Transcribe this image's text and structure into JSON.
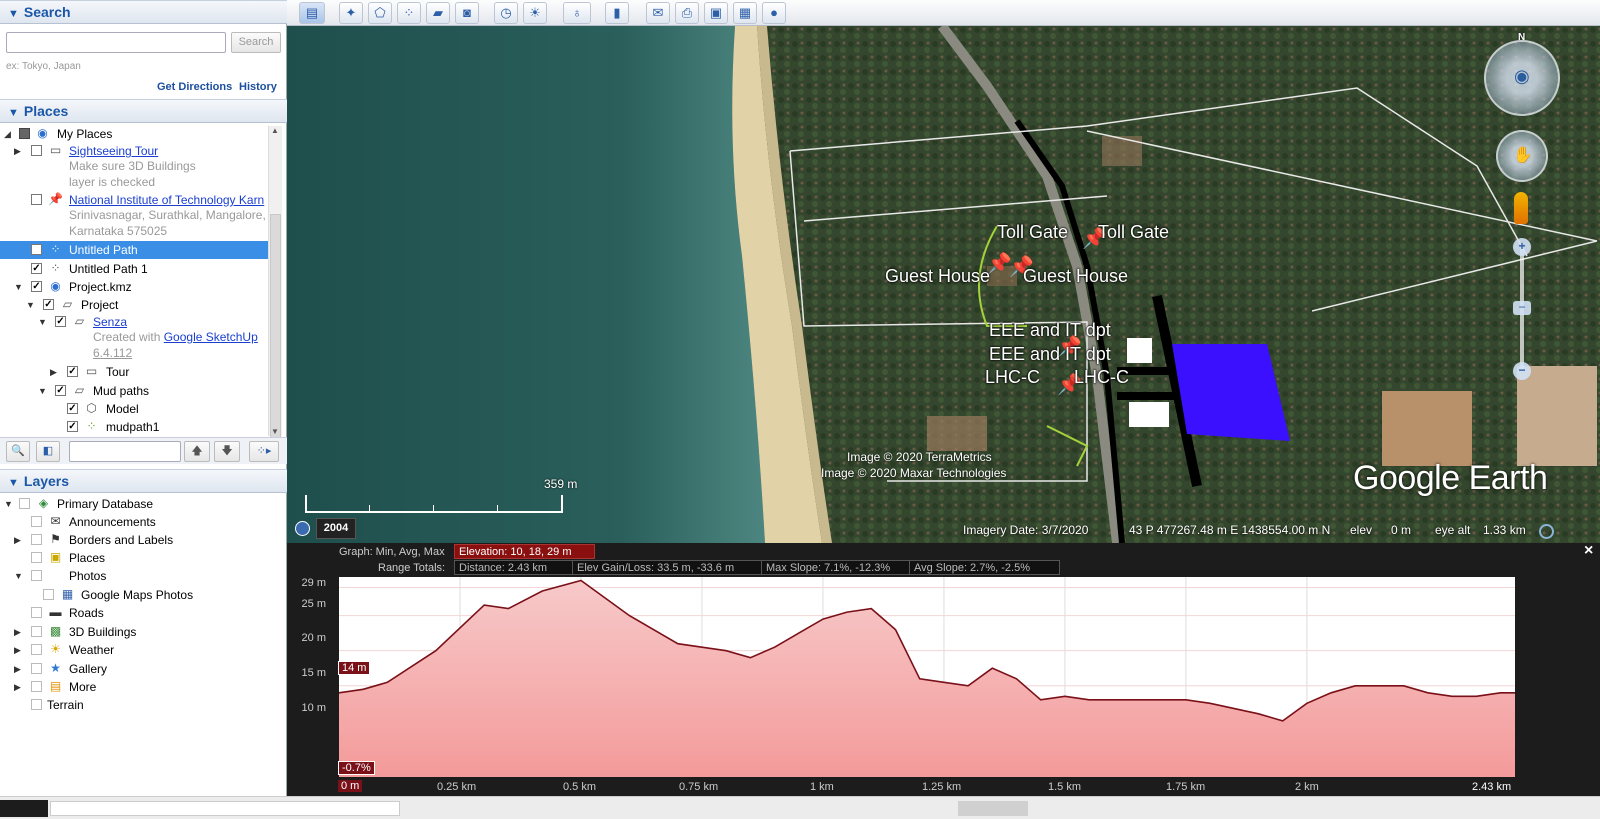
{
  "search": {
    "title": "Search",
    "placeholder": "",
    "button": "Search",
    "hint": "ex: Tokyo, Japan",
    "get_directions": "Get Directions",
    "history": "History"
  },
  "places": {
    "title": "Places",
    "my_places": "My Places",
    "sightseeing": "Sightseeing Tour",
    "sightseeing_desc1": "Make sure 3D Buildings",
    "sightseeing_desc2": "layer is checked",
    "nitk": "National Institute of Technology Karn",
    "nitk_desc1": "Srinivasnagar, Surathkal, Mangalore,",
    "nitk_desc2": "Karnataka 575025",
    "untitled_path": "Untitled Path",
    "untitled_path1": "Untitled Path 1",
    "project_kmz": "Project.kmz",
    "project": "Project",
    "senza": "Senza",
    "senza_desc_prefix": "Created with",
    "senza_desc_link": "Google SketchUp",
    "senza_version": "6.4.112",
    "tour": "Tour",
    "mud_paths": "Mud paths",
    "model": "Model",
    "mudpath1": "mudpath1"
  },
  "layers": {
    "title": "Layers",
    "items": [
      "Primary Database",
      "Announcements",
      "Borders and Labels",
      "Places",
      "Photos",
      "Google Maps Photos",
      "Roads",
      "3D Buildings",
      "Weather",
      "Gallery",
      "More",
      "Terrain"
    ]
  },
  "map": {
    "labels": {
      "toll1": "Toll Gate",
      "toll2": "Toll Gate",
      "guest1": "Guest House",
      "guest2": "Guest House",
      "eee1": "EEE and IT dpt",
      "eee2": "EEE and IT dpt",
      "lhc1": "LHC-C",
      "lhc2": "LHC-C"
    },
    "credit1": "Image © 2020 TerraMetrics",
    "credit2": "Image © 2020 Maxar Technologies",
    "brand": "Google Earth",
    "scale": "359 m",
    "year": "2004",
    "imagery_date": "Imagery Date: 3/7/2020",
    "coords": "43 P 477267.48 m E 1438554.00 m N",
    "elev": "elev",
    "elev_val": "0 m",
    "eye_alt": "eye alt",
    "eye_alt_val": "1.33 km",
    "compass_n": "N"
  },
  "profile": {
    "graph_label": "Graph: Min, Avg, Max",
    "elevation": "Elevation: 10, 18, 29 m",
    "range_label": "Range Totals:",
    "distance": "Distance: 2.43 km",
    "gain": "Elev Gain/Loss: 33.5 m, -33.6 m",
    "max_slope": "Max Slope: 7.1%, -12.3%",
    "avg_slope": "Avg Slope: 2.7%, -2.5%",
    "cursor_elev": "14 m",
    "cursor_slope": "-0.7%",
    "cursor_x": "0 m",
    "y_ticks": [
      "29 m",
      "25 m",
      "20 m",
      "15 m",
      "10 m"
    ],
    "x_ticks": [
      "0.25 km",
      "0.5 km",
      "0.75 km",
      "1 km",
      "1.25 km",
      "1.5 km",
      "1.75 km",
      "2 km",
      "2.43 km"
    ],
    "close": "×"
  },
  "chart_data": {
    "type": "area",
    "xlabel": "",
    "ylabel": "",
    "x": [
      0,
      0.05,
      0.1,
      0.2,
      0.3,
      0.35,
      0.42,
      0.5,
      0.6,
      0.7,
      0.75,
      0.8,
      0.85,
      0.9,
      0.95,
      1.0,
      1.05,
      1.1,
      1.15,
      1.2,
      1.25,
      1.3,
      1.35,
      1.4,
      1.45,
      1.5,
      1.55,
      1.6,
      1.75,
      1.8,
      1.9,
      1.95,
      2.0,
      2.05,
      2.1,
      2.15,
      2.2,
      2.25,
      2.3,
      2.35,
      2.4,
      2.43
    ],
    "values": [
      14,
      14.5,
      15.5,
      20,
      26.5,
      26,
      28.5,
      30,
      25,
      21,
      20.5,
      20,
      19,
      20.5,
      22.5,
      24.5,
      25.5,
      26,
      23,
      16,
      15.5,
      15,
      17.5,
      16,
      13,
      13.5,
      13,
      13,
      13,
      12.5,
      11,
      10,
      12.5,
      14,
      15,
      15,
      15,
      14,
      13.5,
      13.5,
      14,
      14
    ],
    "xlim": [
      0,
      2.43
    ],
    "ylim": [
      2,
      30.5
    ],
    "grid": true
  }
}
